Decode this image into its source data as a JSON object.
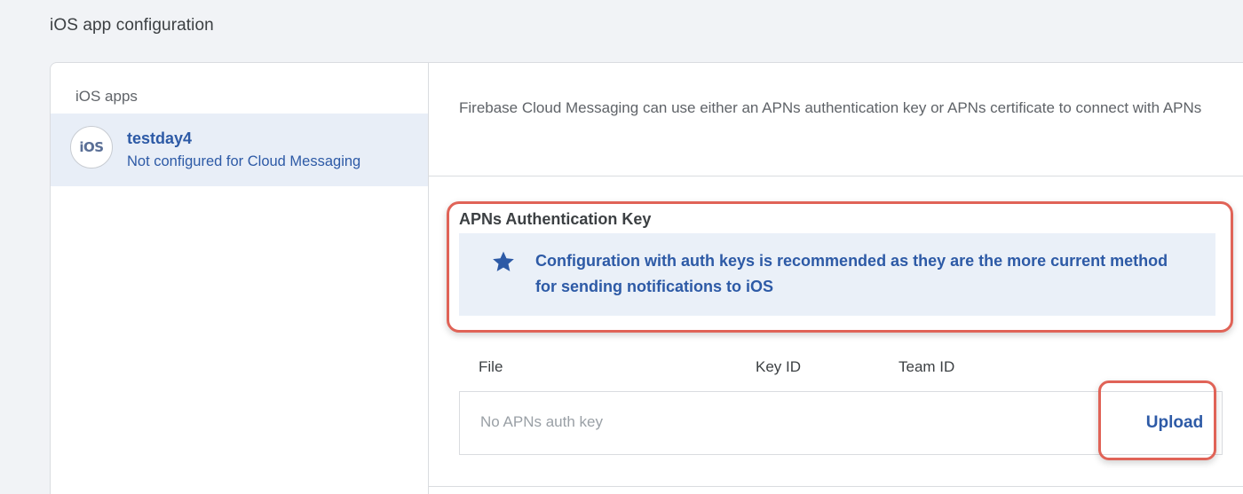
{
  "page": {
    "title": "iOS app configuration"
  },
  "sidebar": {
    "heading": "iOS apps",
    "apps": [
      {
        "icon_text": "iOS",
        "icon": "ios-badge-icon",
        "name": "testday4",
        "status": "Not configured for Cloud Messaging",
        "selected": true
      }
    ]
  },
  "main": {
    "intro": "Firebase Cloud Messaging can use either an APNs authentication key or APNs certificate to connect with APNs",
    "auth_key_section": {
      "title": "APNs Authentication Key",
      "banner": {
        "icon": "star-icon",
        "text": "Configuration with auth keys is recommended as they are the more current method for sending notifications to iOS"
      },
      "columns": [
        "File",
        "Key ID",
        "Team ID"
      ],
      "empty_state": "No APNs auth key",
      "upload_label": "Upload"
    }
  },
  "colors": {
    "accent": "#2d5aa6",
    "banner_background": "#eaf0f8",
    "selected_background": "#e8eef7",
    "highlight_outline": "#e06357"
  }
}
